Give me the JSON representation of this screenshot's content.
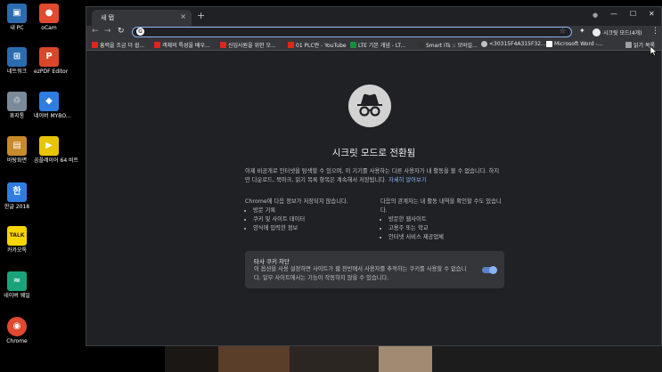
{
  "desktop": {
    "icons": [
      {
        "label": "내 PC",
        "glyph": "▣",
        "color": "#2b6cb0"
      },
      {
        "label": "oCam",
        "glyph": "●",
        "color": "#e04a2f"
      },
      {
        "label": "네트워크",
        "glyph": "⊞",
        "color": "#2b6cb0"
      },
      {
        "label": "ezPDF Editor",
        "glyph": "P",
        "color": "#d9472b"
      },
      {
        "label": "휴지통",
        "glyph": "♲",
        "color": "#7a8a99"
      },
      {
        "label": "네이버 MYBO...",
        "glyph": "◆",
        "color": "#2f7de1"
      },
      {
        "label": "바탕화면",
        "glyph": "▤",
        "color": "#c98a2a"
      },
      {
        "label": "곰플레이어 64 비트",
        "glyph": "▶",
        "color": "#e9c400"
      },
      {
        "label": "한글 2018",
        "glyph": "한",
        "color": "#2f7de1"
      },
      {
        "label": "카카오톡",
        "glyph": "TALK",
        "color": "#f7d600"
      },
      {
        "label": "네이버 웨일",
        "glyph": "≈",
        "color": "#1aa37a"
      },
      {
        "label": "Chrome",
        "glyph": "◉",
        "color": "#e04a2f"
      }
    ]
  },
  "browser": {
    "tab_title": "새 탭",
    "tab_close": "×",
    "new_tab": "+",
    "win_controls": {
      "minimize": "—",
      "maximize": "☐",
      "close": "✕",
      "ext": "●"
    },
    "nav": {
      "back": "←",
      "forward": "→",
      "reload": "↻"
    },
    "omnibox": {
      "value": "",
      "g": "G",
      "star": "☆"
    },
    "extensions_icon": "✦",
    "profile_name": "시크릿 모드(4개)",
    "menu": "⋮",
    "bookmarks": [
      {
        "label": "흥력을 조금 더 쉽...",
        "color": "#e0261b"
      },
      {
        "label": "객체의 특성을 배우...",
        "color": "#e0261b"
      },
      {
        "label": "신입사원을 위한 오...",
        "color": "#e0261b"
      },
      {
        "label": "01 PLC란 - YouTube",
        "color": "#e0261b"
      },
      {
        "label": "LTE 기본 개념 - LT...",
        "color": "#1a8f3a"
      },
      {
        "label": "Smart ITs :: 모바일...",
        "color": "#333333"
      },
      {
        "label": "<30315F4A315F32...",
        "color": "#bdc1c6"
      },
      {
        "label": "Microsoft Word -...",
        "color": "#ffffff"
      }
    ],
    "reading_list": "읽기 목록"
  },
  "incognito": {
    "title": "시크릿 모드로 전환됨",
    "intro": "이제 비공개로 인터넷을 탐색할 수 있으며, 이 기기를 사용하는 다른 사용자가 내 활동을 볼 수 없습니다. 하지만 다운로드, 북마크, 읽기 목록 항목은 계속해서 저장됩니다.",
    "learn_more": "자세히 알아보기",
    "left_heading": "Chrome에 다음 정보가 저장되지 않습니다.",
    "left_items": [
      "방문 기록",
      "쿠키 및 사이트 데이터",
      "양식에 입력한 정보"
    ],
    "right_heading": "다음의 관계자는 내 활동 내역을 확인할 수도 있습니다.",
    "right_items": [
      "방문한 웹사이트",
      "고용주 또는 학교",
      "인터넷 서비스 제공업체"
    ],
    "cookie_title": "타사 쿠키 차단",
    "cookie_desc": "이 옵션을 사용 설정하면 사이트가 웹 전반에서 사용자를 추적하는 쿠키를 사용할 수 없습니다. 일부 사이트에서는 기능이 작동하지 않을 수 있습니다.",
    "cookie_toggle_on": true
  }
}
